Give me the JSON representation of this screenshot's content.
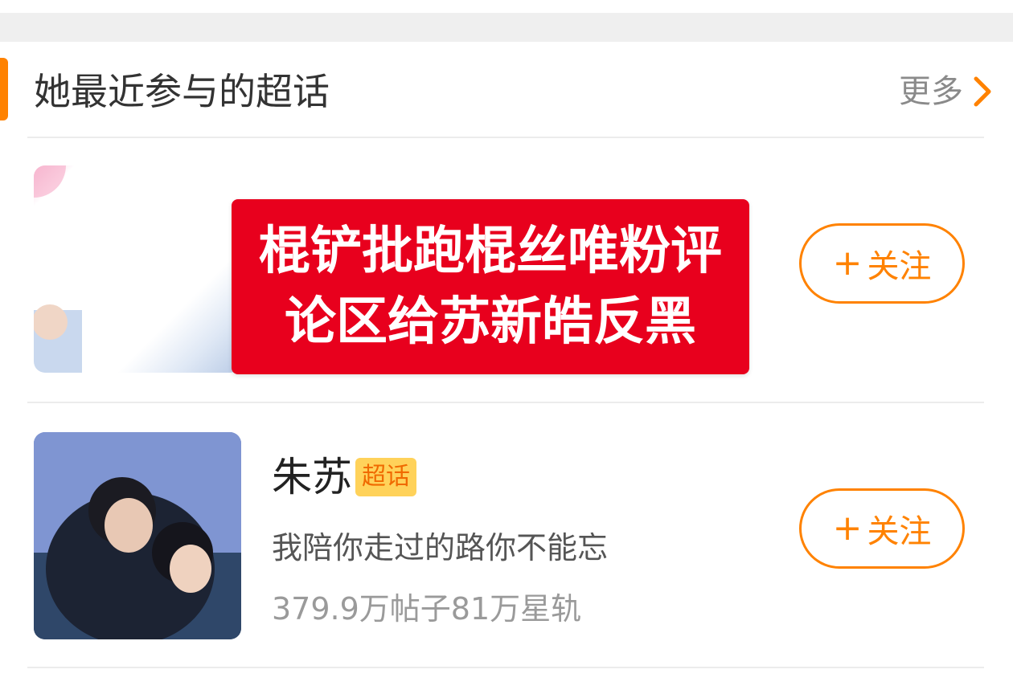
{
  "section": {
    "title": "她最近参与的超话",
    "more_label": "更多",
    "accent_color": "#ff8200",
    "band_color": "#efefef"
  },
  "overlay": {
    "line1": "棍铲批跑棍丝唯粉评",
    "line2": "论区给苏新皓反黑",
    "background": "#e8001d"
  },
  "topics": [
    {
      "name": "",
      "follow_label": "关注",
      "avatar_icon": "topic-avatar"
    },
    {
      "name": "朱苏",
      "badge": "超话",
      "description": "我陪你走过的路你不能忘",
      "stats": "379.9万帖子81万星轨",
      "follow_label": "关注",
      "avatar_icon": "topic-avatar"
    }
  ]
}
